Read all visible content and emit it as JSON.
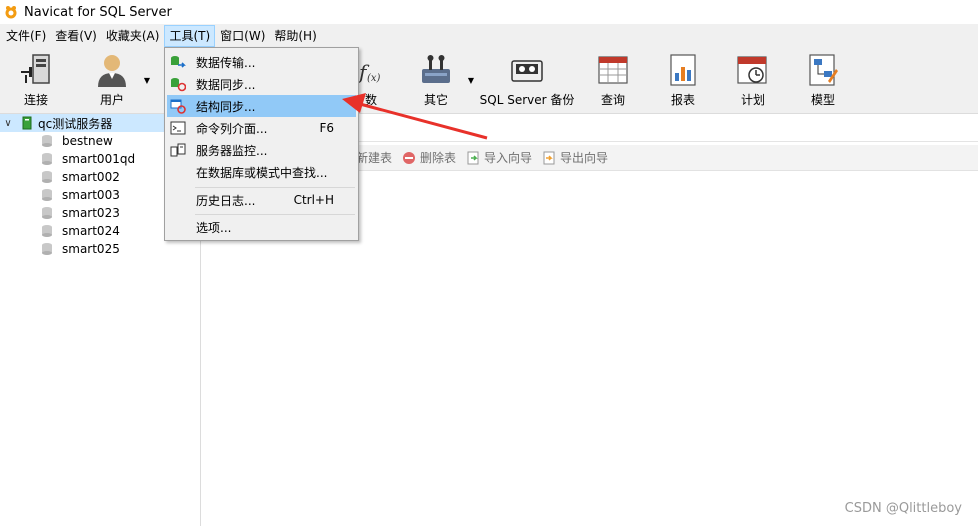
{
  "window": {
    "title": "Navicat for SQL Server"
  },
  "menubar": {
    "items": [
      "文件(F)",
      "查看(V)",
      "收藏夹(A)",
      "工具(T)",
      "窗口(W)",
      "帮助(H)"
    ]
  },
  "toolbar": {
    "connect": "连接",
    "user": "用户",
    "function_partial": "数",
    "other": "其它",
    "backup": "SQL Server 备份",
    "query": "查询",
    "report": "报表",
    "schedule": "计划",
    "model": "模型"
  },
  "sidebar": {
    "server": "qc测试服务器",
    "databases": [
      "bestnew",
      "smart001qd",
      "smart002",
      "smart003",
      "smart023",
      "smart024",
      "smart025"
    ]
  },
  "objbar": {
    "new_table_partial": "新建表",
    "delete_table": "删除表",
    "import_wizard": "导入向导",
    "export_wizard": "导出向导"
  },
  "tools_menu": {
    "data_transfer": "数据传输...",
    "data_sync": "数据同步...",
    "structure_sync": "结构同步...",
    "console": "命令列介面...",
    "console_shortcut": "F6",
    "server_monitor": "服务器监控...",
    "find_in_db": "在数据库或模式中查找...",
    "history_log": "历史日志...",
    "history_shortcut": "Ctrl+H",
    "options": "选项..."
  },
  "watermark": "CSDN @Qlittleboy",
  "colors": {
    "menu_highlight": "#91c9f7",
    "tree_selected": "#cce8ff",
    "arrow": "#e8312a"
  }
}
